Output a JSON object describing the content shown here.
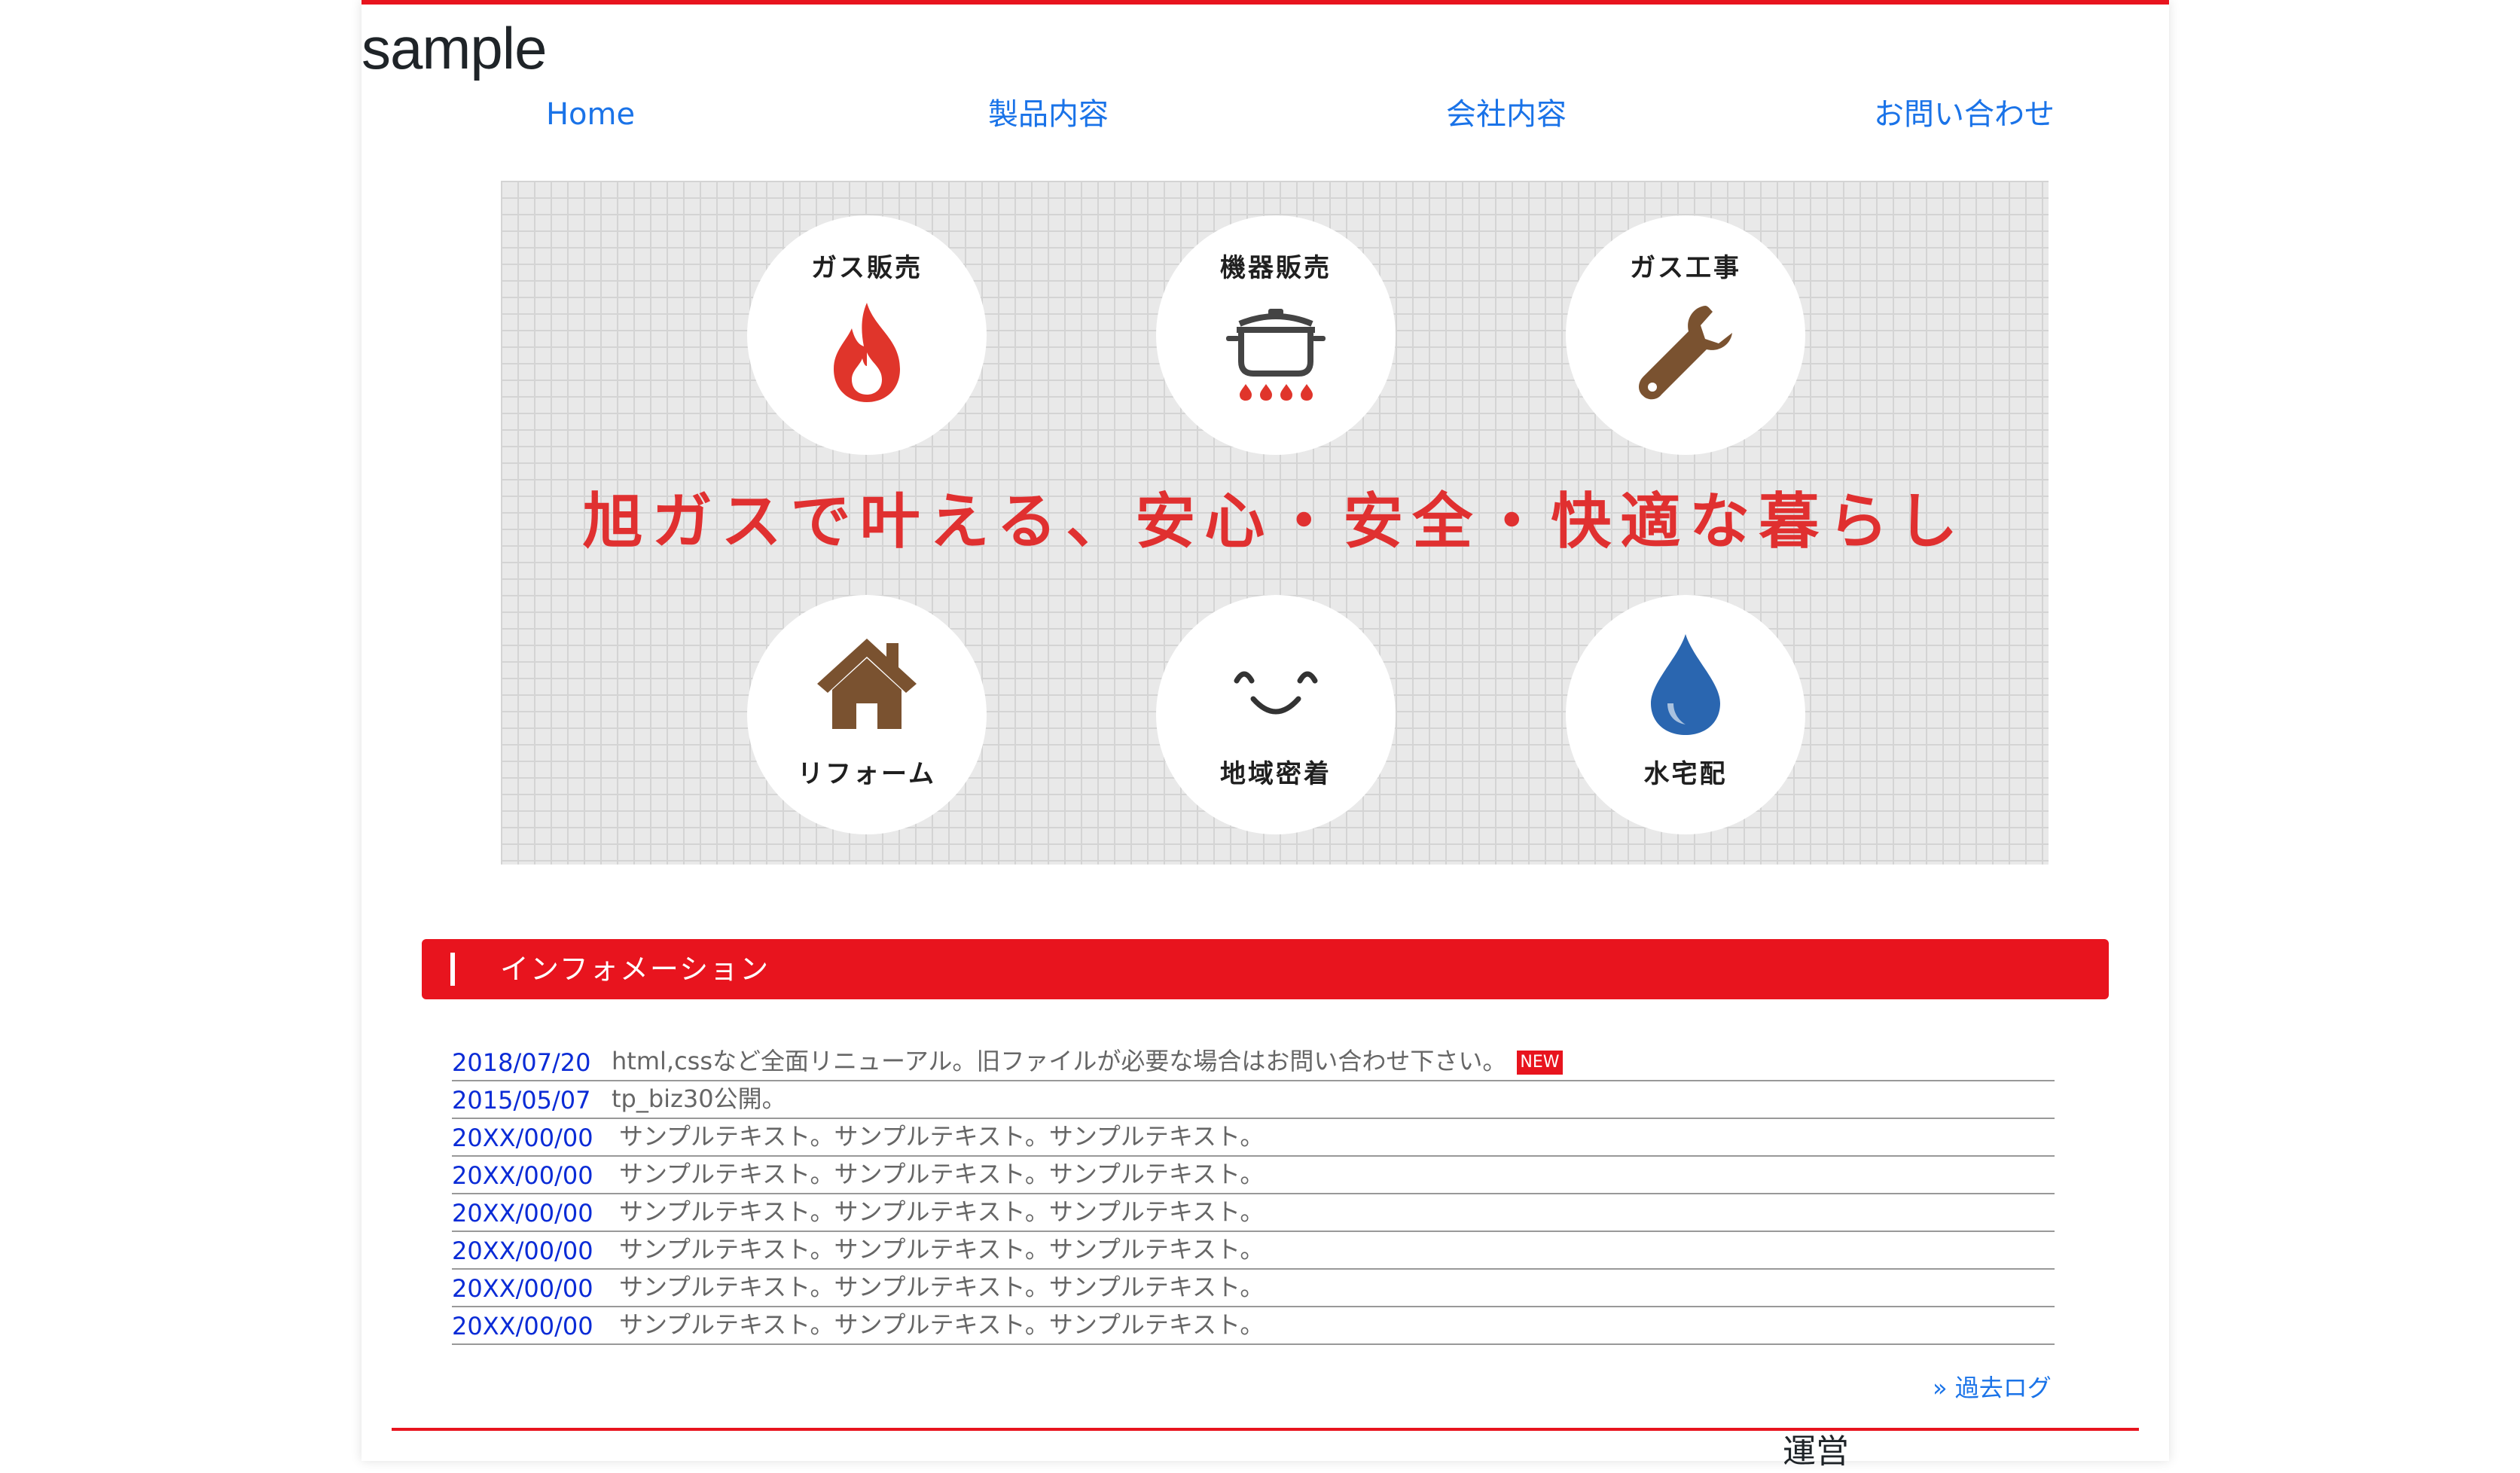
{
  "site": {
    "title": "sample"
  },
  "nav": [
    {
      "label": "Home"
    },
    {
      "label": "製品内容"
    },
    {
      "label": "会社内容"
    },
    {
      "label": "お問い合わせ"
    }
  ],
  "hero": {
    "tagline": "旭ガスで叶える、安心・安全・快適な暮らし",
    "services": [
      {
        "label": "ガス販売",
        "icon": "flame-icon"
      },
      {
        "label": "機器販売",
        "icon": "pot-on-stove-icon"
      },
      {
        "label": "ガス工事",
        "icon": "wrench-icon"
      },
      {
        "label": "リフォーム",
        "icon": "house-icon"
      },
      {
        "label": "地域密着",
        "icon": "smile-icon"
      },
      {
        "label": "水宅配",
        "icon": "water-drop-icon"
      }
    ]
  },
  "info": {
    "title": "インフォメーション",
    "new_badge": "NEW",
    "items": [
      {
        "date": "2018/07/20",
        "text": "html,cssなど全面リニューアル。旧ファイルが必要な場合はお問い合わせ下さい。"
      },
      {
        "date": "2015/05/07",
        "text": "tp_biz30公開。"
      },
      {
        "date": "20XX/00/00",
        "text": "サンプルテキスト。サンプルテキスト。サンプルテキスト。"
      },
      {
        "date": "20XX/00/00",
        "text": "サンプルテキスト。サンプルテキスト。サンプルテキスト。"
      },
      {
        "date": "20XX/00/00",
        "text": "サンプルテキスト。サンプルテキスト。サンプルテキスト。"
      },
      {
        "date": "20XX/00/00",
        "text": "サンプルテキスト。サンプルテキスト。サンプルテキスト。"
      },
      {
        "date": "20XX/00/00",
        "text": "サンプルテキスト。サンプルテキスト。サンプルテキスト。"
      },
      {
        "date": "20XX/00/00",
        "text": "サンプルテキスト。サンプルテキスト。サンプルテキスト。"
      }
    ],
    "past_log": "» 過去ログ"
  },
  "footer": {
    "heading": "運営"
  },
  "colors": {
    "brand_red": "#e8141e",
    "link_blue": "#1a73e8",
    "date_blue": "#0a2bd6",
    "icon_brown": "#7a5230",
    "icon_blue": "#2a66b0"
  }
}
